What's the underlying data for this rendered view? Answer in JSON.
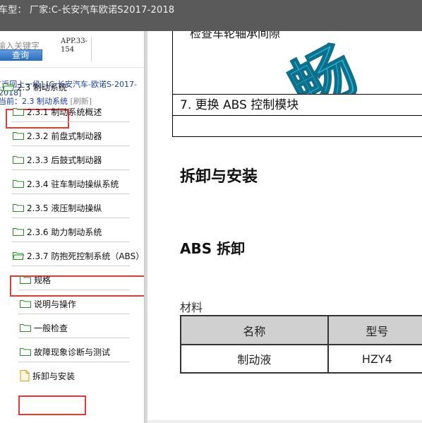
{
  "titlebar": {
    "text": "车型：  厂家:C-长安汽车欧诺S2017-2018"
  },
  "sidebar": {
    "search_placeholder": "输入关键字",
    "search_button": "查询",
    "app_code": "APP.33-154",
    "back_link": "[返回上一级]",
    "back_scope": "[C-长安汽车-欧诺S-2017-2018]",
    "current_prefix": "当前：",
    "current_value": "2.3 制动系统",
    "refresh": "[刷新]",
    "tree": [
      {
        "label": "2.3 制动系统",
        "type": "folder-open"
      },
      {
        "label": "2.3.1 制动系统概述",
        "type": "folder"
      },
      {
        "label": "2.3.2 前盘式制动器",
        "type": "folder"
      },
      {
        "label": "2.3.3 后鼓式制动器",
        "type": "folder"
      },
      {
        "label": "2.3.4 驻车制动操纵系统",
        "type": "folder"
      },
      {
        "label": "2.3.5 液压制动操纵",
        "type": "folder"
      },
      {
        "label": "2.3.6 助力制动系统",
        "type": "folder"
      },
      {
        "label": "2.3.7 防抱死控制系统（ABS）",
        "type": "folder-open"
      },
      {
        "label": "规格",
        "type": "folder"
      },
      {
        "label": "说明与操作",
        "type": "folder"
      },
      {
        "label": "一般检查",
        "type": "folder"
      },
      {
        "label": "故障现象诊断与测试",
        "type": "folder"
      },
      {
        "label": "拆卸与安装",
        "type": "document"
      }
    ]
  },
  "content": {
    "watermark": "畅",
    "step_prev_text": "检查车轮轴承间隙",
    "step7": "7. 更换  ABS 控制模块",
    "heading_main": "拆卸与安装",
    "heading_sub": "ABS 拆卸",
    "materials_label": "材料",
    "materials_table": {
      "headers": [
        "名称",
        "型号"
      ],
      "rows": [
        [
          "制动液",
          "HZY4"
        ]
      ]
    }
  },
  "colors": {
    "titlebar_bg": "#5a5a5a",
    "highlight": "#e23a3a",
    "folder": "#2e8b2e",
    "link": "#1a3d9c",
    "search_button": "#2d6fc0",
    "watermark": "#1fb3d6"
  }
}
